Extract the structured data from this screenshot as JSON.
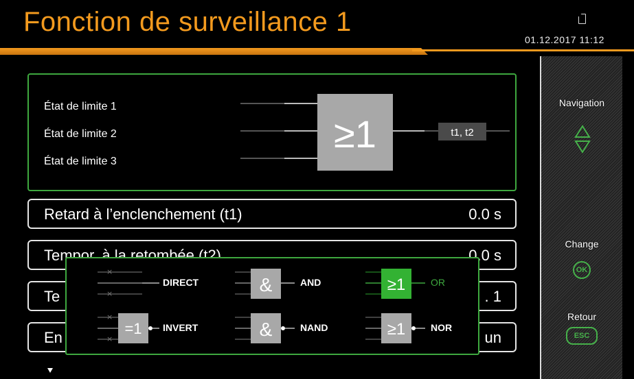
{
  "header": {
    "title": "Fonction de surveillance 1",
    "datetime": "01.12.2017 11:12"
  },
  "sidebar": {
    "navigation": "Navigation",
    "change": "Change",
    "ok": "OK",
    "retour": "Retour",
    "esc": "ESC"
  },
  "logic": {
    "inputs": [
      "État de limite 1",
      "État de limite 2",
      "État de limite 3"
    ],
    "gate_symbol": "≥1",
    "output": "t1, t2"
  },
  "rows": [
    {
      "label": "Retard à l’enclenchement (t1)",
      "value": "0.0 s"
    },
    {
      "label": "Tempor. à la retombée (t2)",
      "value": "0.0 s"
    },
    {
      "label": "Te",
      "value": ". 1"
    },
    {
      "label": "En",
      "value": "un"
    }
  ],
  "gate_types": {
    "direct": "DIRECT",
    "and": "AND",
    "or": "OR",
    "invert": "INVERT",
    "nand": "NAND",
    "nor": "NOR",
    "and_symbol": "&",
    "or_symbol": "≥1",
    "invert_symbol": "=1",
    "cross_mark": "×",
    "selected": "OR"
  },
  "colors": {
    "accent_orange": "#f39a1e",
    "frame_green": "#3ea83f",
    "gate_grey": "#a8a8a8"
  }
}
